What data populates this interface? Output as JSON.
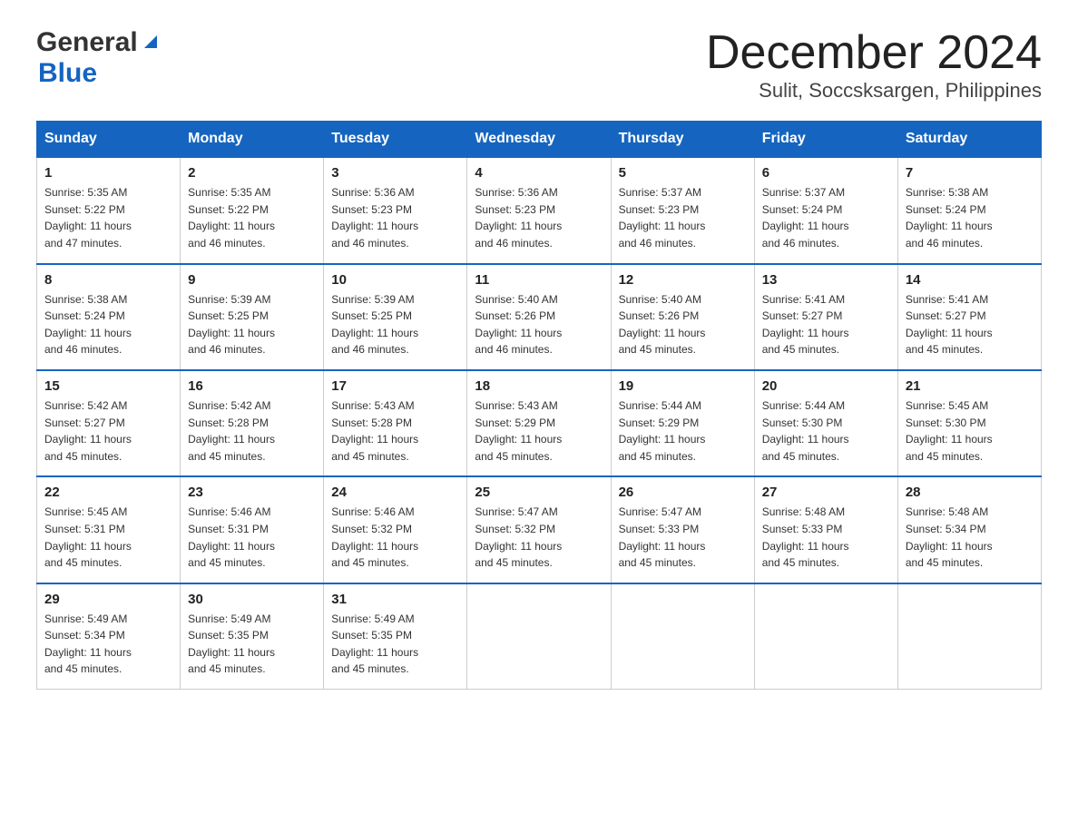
{
  "header": {
    "logo_general": "General",
    "logo_blue": "Blue",
    "title": "December 2024",
    "subtitle": "Sulit, Soccsksargen, Philippines"
  },
  "weekdays": [
    "Sunday",
    "Monday",
    "Tuesday",
    "Wednesday",
    "Thursday",
    "Friday",
    "Saturday"
  ],
  "weeks": [
    [
      {
        "day": "1",
        "sunrise": "5:35 AM",
        "sunset": "5:22 PM",
        "daylight": "11 hours and 47 minutes."
      },
      {
        "day": "2",
        "sunrise": "5:35 AM",
        "sunset": "5:22 PM",
        "daylight": "11 hours and 46 minutes."
      },
      {
        "day": "3",
        "sunrise": "5:36 AM",
        "sunset": "5:23 PM",
        "daylight": "11 hours and 46 minutes."
      },
      {
        "day": "4",
        "sunrise": "5:36 AM",
        "sunset": "5:23 PM",
        "daylight": "11 hours and 46 minutes."
      },
      {
        "day": "5",
        "sunrise": "5:37 AM",
        "sunset": "5:23 PM",
        "daylight": "11 hours and 46 minutes."
      },
      {
        "day": "6",
        "sunrise": "5:37 AM",
        "sunset": "5:24 PM",
        "daylight": "11 hours and 46 minutes."
      },
      {
        "day": "7",
        "sunrise": "5:38 AM",
        "sunset": "5:24 PM",
        "daylight": "11 hours and 46 minutes."
      }
    ],
    [
      {
        "day": "8",
        "sunrise": "5:38 AM",
        "sunset": "5:24 PM",
        "daylight": "11 hours and 46 minutes."
      },
      {
        "day": "9",
        "sunrise": "5:39 AM",
        "sunset": "5:25 PM",
        "daylight": "11 hours and 46 minutes."
      },
      {
        "day": "10",
        "sunrise": "5:39 AM",
        "sunset": "5:25 PM",
        "daylight": "11 hours and 46 minutes."
      },
      {
        "day": "11",
        "sunrise": "5:40 AM",
        "sunset": "5:26 PM",
        "daylight": "11 hours and 46 minutes."
      },
      {
        "day": "12",
        "sunrise": "5:40 AM",
        "sunset": "5:26 PM",
        "daylight": "11 hours and 45 minutes."
      },
      {
        "day": "13",
        "sunrise": "5:41 AM",
        "sunset": "5:27 PM",
        "daylight": "11 hours and 45 minutes."
      },
      {
        "day": "14",
        "sunrise": "5:41 AM",
        "sunset": "5:27 PM",
        "daylight": "11 hours and 45 minutes."
      }
    ],
    [
      {
        "day": "15",
        "sunrise": "5:42 AM",
        "sunset": "5:27 PM",
        "daylight": "11 hours and 45 minutes."
      },
      {
        "day": "16",
        "sunrise": "5:42 AM",
        "sunset": "5:28 PM",
        "daylight": "11 hours and 45 minutes."
      },
      {
        "day": "17",
        "sunrise": "5:43 AM",
        "sunset": "5:28 PM",
        "daylight": "11 hours and 45 minutes."
      },
      {
        "day": "18",
        "sunrise": "5:43 AM",
        "sunset": "5:29 PM",
        "daylight": "11 hours and 45 minutes."
      },
      {
        "day": "19",
        "sunrise": "5:44 AM",
        "sunset": "5:29 PM",
        "daylight": "11 hours and 45 minutes."
      },
      {
        "day": "20",
        "sunrise": "5:44 AM",
        "sunset": "5:30 PM",
        "daylight": "11 hours and 45 minutes."
      },
      {
        "day": "21",
        "sunrise": "5:45 AM",
        "sunset": "5:30 PM",
        "daylight": "11 hours and 45 minutes."
      }
    ],
    [
      {
        "day": "22",
        "sunrise": "5:45 AM",
        "sunset": "5:31 PM",
        "daylight": "11 hours and 45 minutes."
      },
      {
        "day": "23",
        "sunrise": "5:46 AM",
        "sunset": "5:31 PM",
        "daylight": "11 hours and 45 minutes."
      },
      {
        "day": "24",
        "sunrise": "5:46 AM",
        "sunset": "5:32 PM",
        "daylight": "11 hours and 45 minutes."
      },
      {
        "day": "25",
        "sunrise": "5:47 AM",
        "sunset": "5:32 PM",
        "daylight": "11 hours and 45 minutes."
      },
      {
        "day": "26",
        "sunrise": "5:47 AM",
        "sunset": "5:33 PM",
        "daylight": "11 hours and 45 minutes."
      },
      {
        "day": "27",
        "sunrise": "5:48 AM",
        "sunset": "5:33 PM",
        "daylight": "11 hours and 45 minutes."
      },
      {
        "day": "28",
        "sunrise": "5:48 AM",
        "sunset": "5:34 PM",
        "daylight": "11 hours and 45 minutes."
      }
    ],
    [
      {
        "day": "29",
        "sunrise": "5:49 AM",
        "sunset": "5:34 PM",
        "daylight": "11 hours and 45 minutes."
      },
      {
        "day": "30",
        "sunrise": "5:49 AM",
        "sunset": "5:35 PM",
        "daylight": "11 hours and 45 minutes."
      },
      {
        "day": "31",
        "sunrise": "5:49 AM",
        "sunset": "5:35 PM",
        "daylight": "11 hours and 45 minutes."
      },
      null,
      null,
      null,
      null
    ]
  ],
  "labels": {
    "sunrise": "Sunrise:",
    "sunset": "Sunset:",
    "daylight": "Daylight:"
  }
}
